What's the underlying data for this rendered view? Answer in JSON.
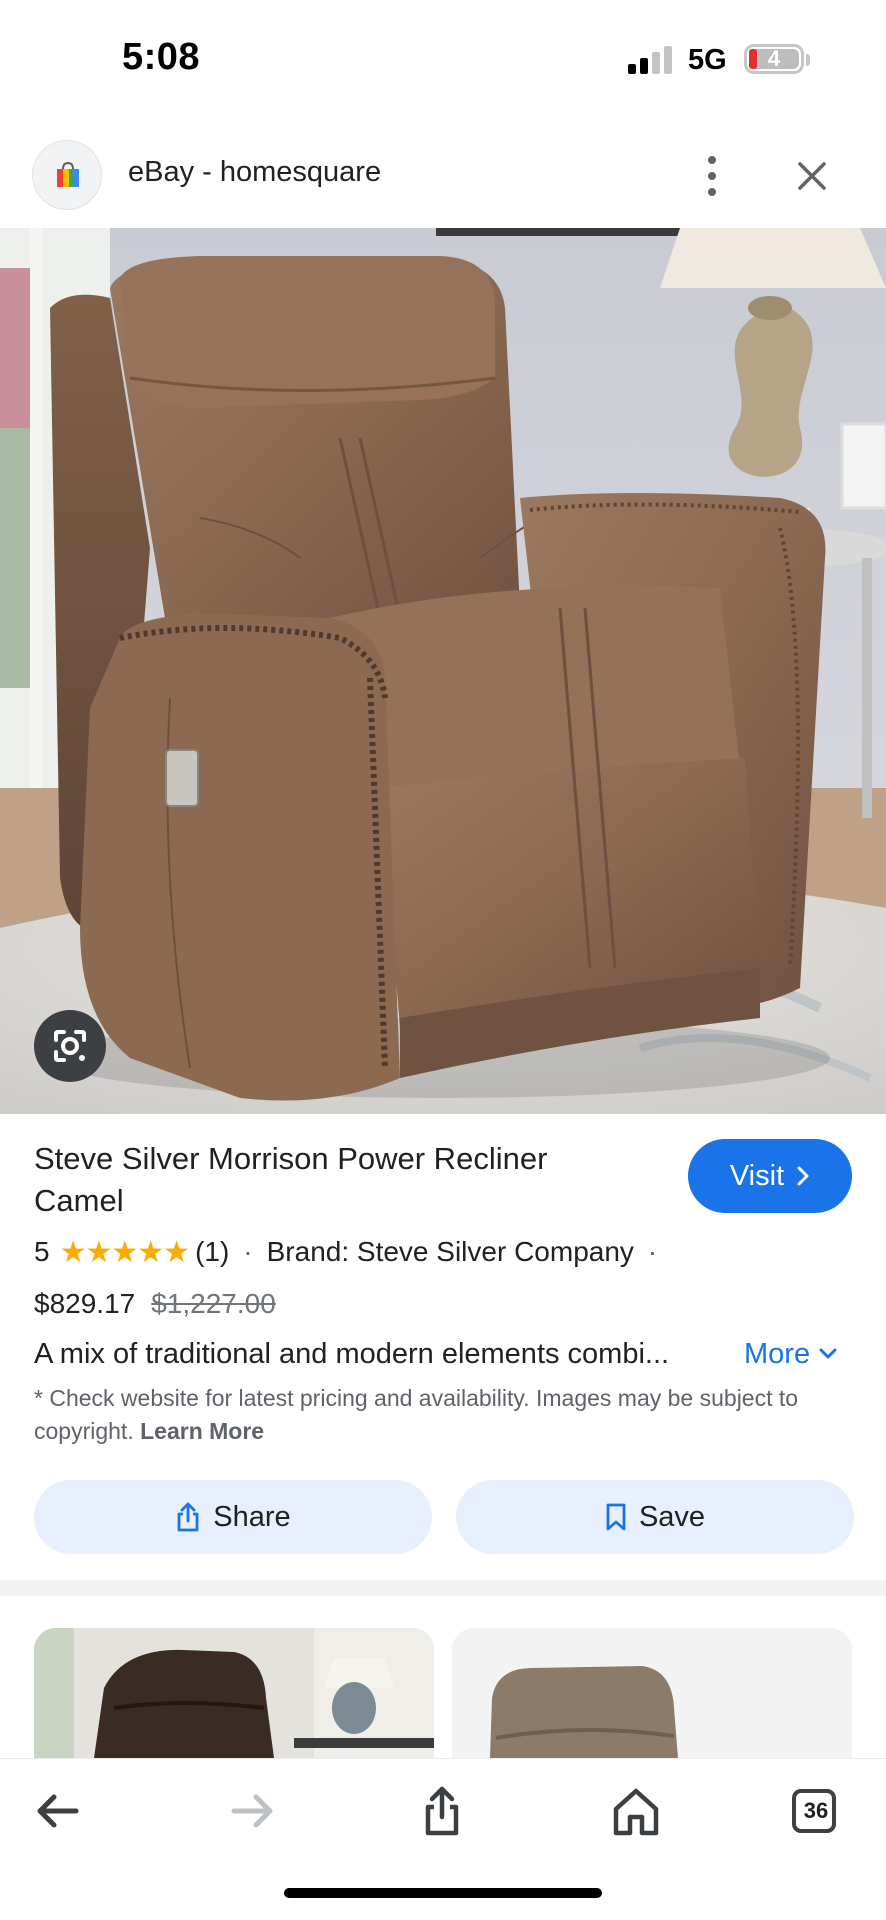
{
  "status_bar": {
    "time": "5:08",
    "network": "5G",
    "battery": "4"
  },
  "header": {
    "site_title": "eBay - homesquare",
    "favicon_icon": "shopping-bag-icon",
    "menu_icon": "more-vert-icon",
    "close_icon": "close-icon"
  },
  "hero": {
    "lens_icon": "google-lens-icon"
  },
  "product": {
    "title": "Steve Silver Morrison Power Recliner Camel",
    "visit_label": "Visit",
    "rating_value": "5",
    "rating_stars": 5,
    "review_count": "(1)",
    "brand": "Brand: Steve Silver Company",
    "price": "$829.17",
    "old_price": "$1,227.00",
    "description": "A mix of traditional and modern elements combi...",
    "more_label": "More",
    "disclaimer": "* Check website for latest pricing and availability. Images may be subject to copyright.",
    "learn_more": "Learn More"
  },
  "actions": {
    "share_label": "Share",
    "save_label": "Save"
  },
  "toolbar": {
    "tab_count": "36"
  },
  "colors": {
    "accent": "#1a73e8",
    "star": "#f9ab00",
    "pill_bg": "#e8f0fe",
    "recliner": "#8d6a52"
  }
}
